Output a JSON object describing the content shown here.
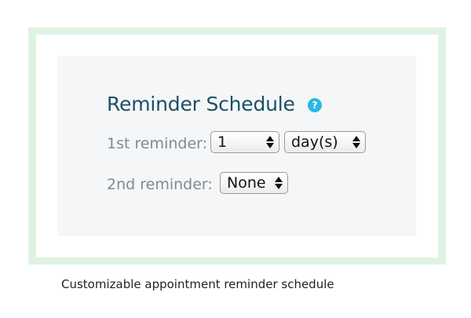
{
  "title": "Reminder Schedule",
  "help_icon": "question-mark-circle-icon",
  "help_glyph": "?",
  "first_reminder": {
    "label": "1st reminder:",
    "amount": "1",
    "unit": "day(s)"
  },
  "second_reminder": {
    "label": "2nd reminder:",
    "value": "None"
  },
  "caption": "Customizable appointment reminder schedule",
  "colors": {
    "title": "#1d4f66",
    "help_icon": "#2bb8e0",
    "frame": "#dff3e4",
    "panel": "#f4f6f7",
    "label": "#7c8d8e"
  }
}
